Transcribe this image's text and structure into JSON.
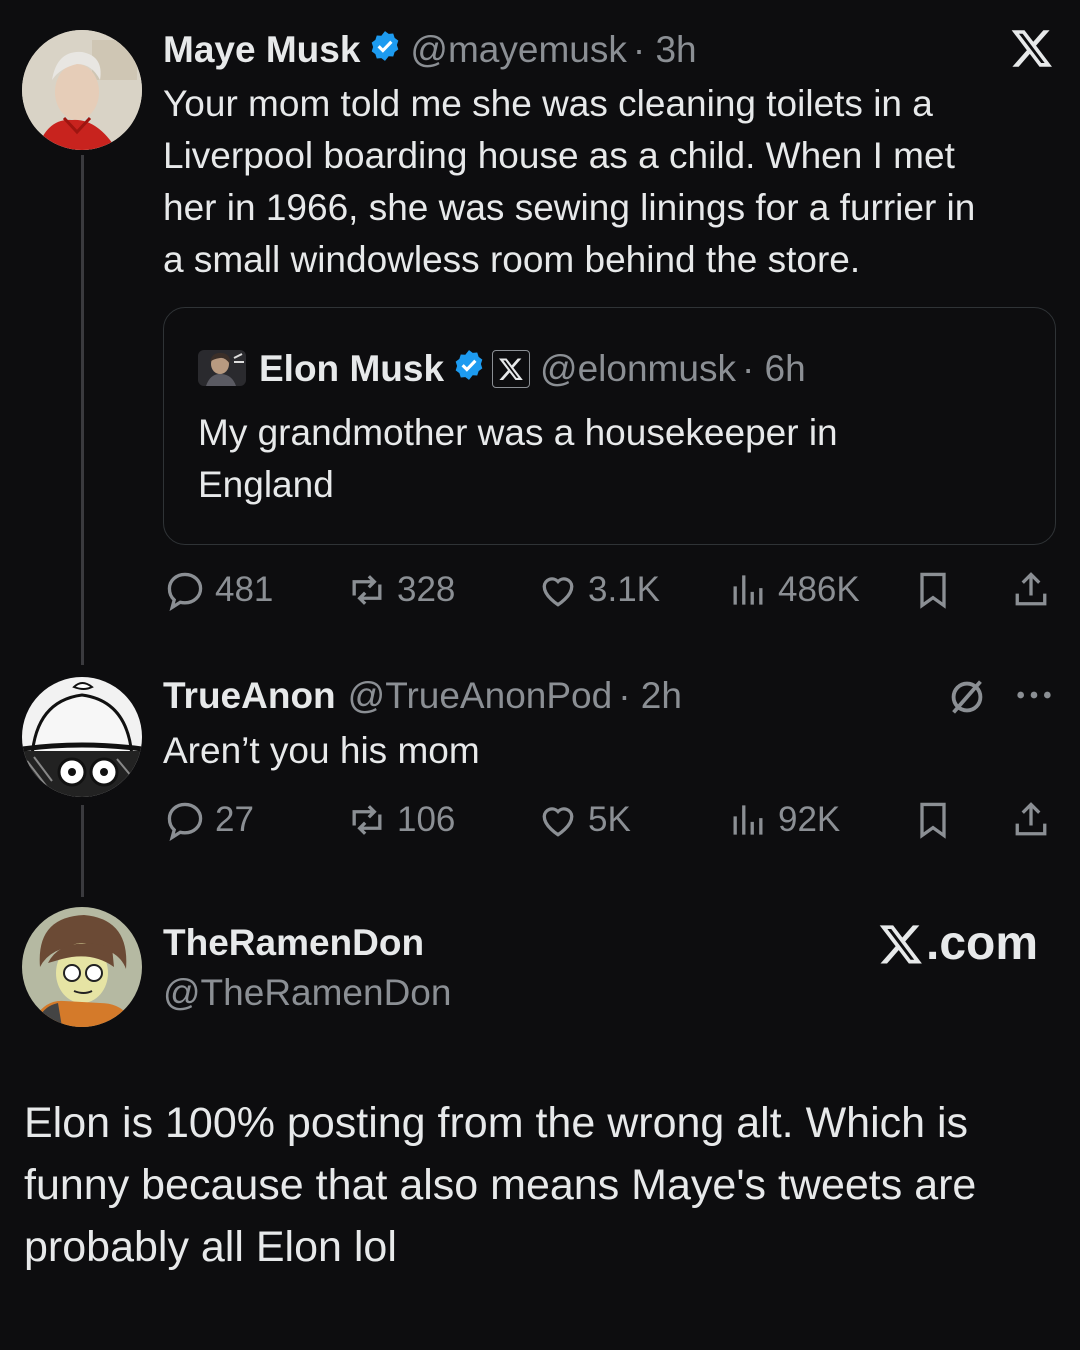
{
  "tweet1": {
    "name": "Maye Musk",
    "handle": "@mayemusk",
    "time": "· 3h",
    "text_lines": [
      "Your mom told me she was cleaning toilets in a",
      "Liverpool boarding house as a child. When I met",
      "her in 1966, she was sewing linings for a furrier in",
      "a small windowless room behind the store."
    ],
    "quote": {
      "name": "Elon Musk",
      "handle": "@elonmusk",
      "time": "· 6h",
      "text_lines": [
        "My grandmother was a housekeeper in",
        "England"
      ]
    },
    "actions": {
      "replies": "481",
      "reposts": "328",
      "likes": "3.1K",
      "views": "486K"
    }
  },
  "tweet2": {
    "name": "TrueAnon",
    "handle": "@TrueAnonPod",
    "time": "· 2h",
    "text": "Aren’t you his mom",
    "actions": {
      "replies": "27",
      "reposts": "106",
      "likes": "5K",
      "views": "92K"
    }
  },
  "tweet3": {
    "name": "TheRamenDon",
    "handle": "@TheRamenDon",
    "site_label": ".com",
    "text_lines": [
      "Elon is 100% posting from the wrong alt. Which is",
      "funny because that also means Maye's tweets are",
      "probably all Elon lol"
    ]
  },
  "colors": {
    "background": "#0d0d0f",
    "text": "#e7e9ea",
    "muted": "#8b8f94",
    "verified": "#1d9bf0",
    "border": "#2f3336"
  },
  "icons": [
    "x-logo-icon",
    "verified-badge-icon",
    "reply-icon",
    "repost-icon",
    "like-icon",
    "views-icon",
    "bookmark-icon",
    "share-icon",
    "grok-icon",
    "more-icon"
  ]
}
